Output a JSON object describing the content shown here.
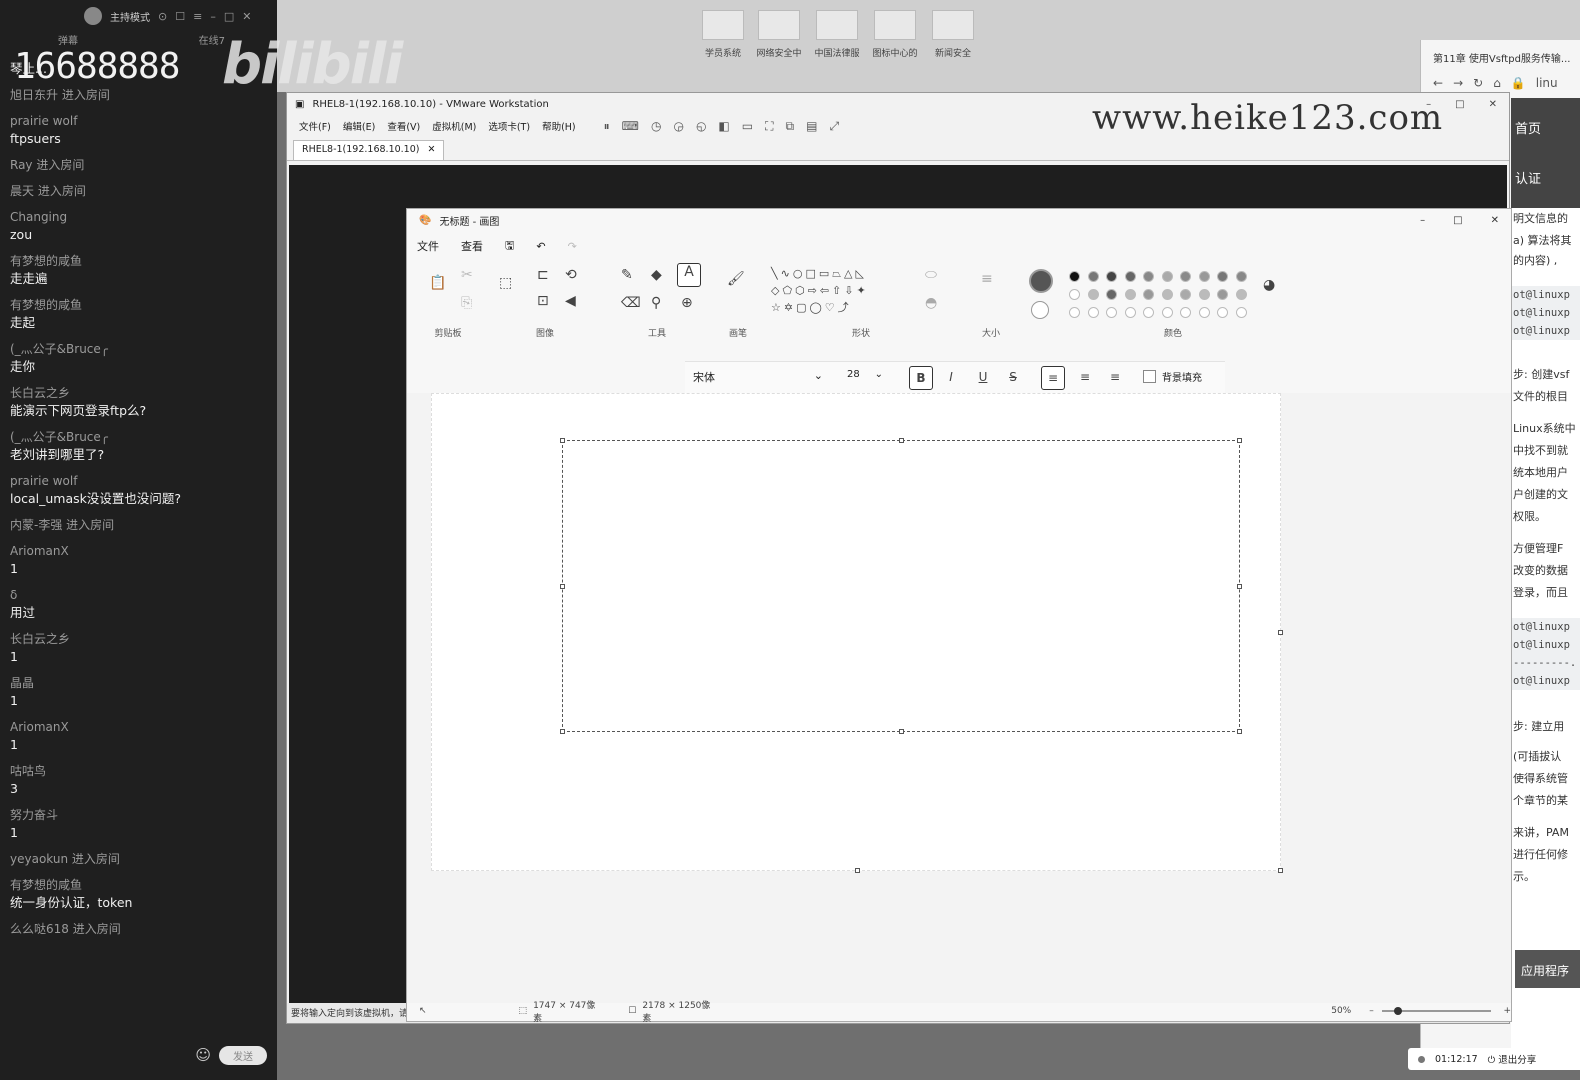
{
  "chat": {
    "mode": "主持模式",
    "tab_left": "弹幕",
    "tab_right": "在线7",
    "watermark_number": "16688888",
    "watermark_logo": "bilibili",
    "messages": [
      {
        "user": "",
        "text": "琴止..."
      },
      {
        "user": "旭日东升 进入房间",
        "text": ""
      },
      {
        "user": "prairie wolf",
        "text": "ftpsuers"
      },
      {
        "user": "Ray 进入房间",
        "text": ""
      },
      {
        "user": "晨天 进入房间",
        "text": ""
      },
      {
        "user": "Changing",
        "text": "zou"
      },
      {
        "user": "有梦想的咸鱼",
        "text": "走走遍"
      },
      {
        "user": "有梦想的咸鱼",
        "text": "走起"
      },
      {
        "user": "(_灬公子&Bruce╭",
        "text": "走你"
      },
      {
        "user": "长白云之乡",
        "text": "能演示下网页登录ftp么?"
      },
      {
        "user": "(_灬公子&Bruce╭",
        "text": "老刘讲到哪里了?"
      },
      {
        "user": "prairie wolf",
        "text": "local_umask没设置也没问题?"
      },
      {
        "user": "内蒙-李强 进入房间",
        "text": ""
      },
      {
        "user": "AriomanX",
        "text": "1"
      },
      {
        "user": "δ",
        "text": "用过"
      },
      {
        "user": "长白云之乡",
        "text": "1"
      },
      {
        "user": "晶晶",
        "text": "1"
      },
      {
        "user": "AriomanX",
        "text": "1"
      },
      {
        "user": "咕咕鸟",
        "text": "3"
      },
      {
        "user": "努力奋斗",
        "text": "1"
      },
      {
        "user": "yeyaokun 进入房间",
        "text": ""
      },
      {
        "user": "有梦想的咸鱼",
        "text": "统一身份认证，token"
      },
      {
        "user": "么么哒618 进入房间",
        "text": ""
      }
    ],
    "send_label": "发送"
  },
  "desktop": {
    "icons": [
      "学员系统",
      "网络安全中",
      "中国法律服",
      "图标中心的",
      "新闻安全"
    ],
    "site_url": "www.heike123.com"
  },
  "browser": {
    "tab_title": "第11章 使用Vsftpd服务传输...",
    "tab_right": "linu",
    "hero_line1": "首页",
    "hero_line2": "认证",
    "lines": [
      "明文信息的",
      "a) 算法将其",
      "的内容) ,",
      "步: 创建vsf",
      "文件的根目",
      "Linux系统中",
      "中找不到就",
      "统本地用户",
      "户创建的文",
      "权限。",
      "方便管理F",
      "改变的数据",
      "登录，而且",
      "步: 建立用",
      "(可插拔认",
      "使得系统管",
      "个章节的某",
      "来讲，PAM",
      "进行任何修",
      "示。"
    ],
    "code_block1": [
      "ot@linuxp",
      "ot@linuxp",
      "ot@linuxp"
    ],
    "code_block2": [
      "ot@linuxp",
      "ot@linuxp",
      "---------.",
      "ot@linuxp"
    ],
    "button": "应用程序"
  },
  "vmware": {
    "title": "RHEL8-1(192.168.10.10) - VMware Workstation",
    "menu": [
      "文件(F)",
      "编辑(E)",
      "查看(V)",
      "虚拟机(M)",
      "选项卡(T)",
      "帮助(H)"
    ],
    "tab": "RHEL8-1(192.168.10.10)",
    "status": "要将输入定向到该虚拟机，请..."
  },
  "paint": {
    "title": "无标题 - 画图",
    "menu": [
      "文件",
      "查看"
    ],
    "groups": [
      "剪贴板",
      "图像",
      "工具",
      "画笔",
      "形状",
      "大小",
      "颜色"
    ],
    "font": "宋体",
    "font_size": "28",
    "bg_fill": "背景填充",
    "selection": "1747 × 747像素",
    "canvas_size": "2178 × 1250像素",
    "zoom": "50%"
  },
  "bottom_bar": {
    "time": "01:12:17",
    "exit_share": "退出分享"
  }
}
